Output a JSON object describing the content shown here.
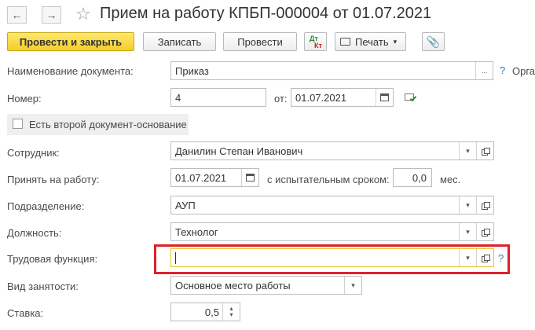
{
  "header": {
    "back_icon": "arrow-left-icon",
    "forward_icon": "arrow-right-icon",
    "favorite_icon": "star-icon",
    "title": "Прием на работу КПБП-000004 от 01.07.2021"
  },
  "toolbar": {
    "post_close_label": "Провести и закрыть",
    "save_label": "Записать",
    "post_label": "Провести",
    "dt_label": "Дт",
    "kt_label": "Кт",
    "print_label": "Печать",
    "print_icon": "printer-icon",
    "attach_icon": "paperclip-icon"
  },
  "form": {
    "doc_name_label": "Наименование документа:",
    "doc_name_value": "Приказ",
    "doc_name_more": "...",
    "doc_name_help": "?",
    "doc_name_trailing": "Орга",
    "number_label": "Номер:",
    "number_value": "4",
    "from_label": "от:",
    "date_value": "01.07.2021",
    "second_doc_label": "Есть второй документ-основание",
    "employee_label": "Сотрудник:",
    "employee_value": "Данилин Степан Иванович",
    "hire_label": "Принять на работу:",
    "hire_date": "01.07.2021",
    "probation_label": "с испытательным сроком:",
    "probation_value": "0,0",
    "months_label": "мес.",
    "department_label": "Подразделение:",
    "department_value": "АУП",
    "position_label": "Должность:",
    "position_value": "Технолог",
    "labor_function_label": "Трудовая функция:",
    "labor_function_value": "",
    "labor_function_help": "?",
    "employment_type_label": "Вид занятости:",
    "employment_type_value": "Основное место работы",
    "rate_label": "Ставка:",
    "rate_value": "0,5"
  },
  "colors": {
    "primary_button": "#f5cd2b",
    "highlight": "#e0202a",
    "active_field_border": "#e5c52a",
    "help_link": "#2a7fc6"
  }
}
